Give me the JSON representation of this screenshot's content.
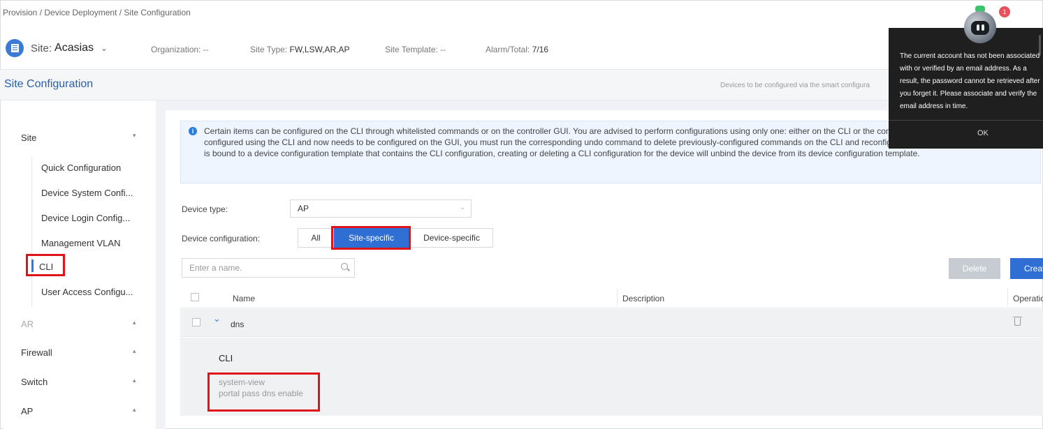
{
  "breadcrumb": "Provision / Device Deployment / Site Configuration",
  "site": {
    "label": "Site:",
    "name": "Acasias",
    "organization": "Organization: --",
    "site_type_label": "Site Type:",
    "site_type_value": "FW,LSW,AR,AP",
    "site_template": "Site Template: --",
    "alarm_label": "Alarm/Total:",
    "alarm_value": "7/16"
  },
  "section": {
    "title": "Site Configuration",
    "smart_note": "Devices to be configured via the smart configura"
  },
  "sidebar": {
    "groups": [
      {
        "label": "Site"
      },
      {
        "label": "AR"
      },
      {
        "label": "Firewall"
      },
      {
        "label": "Switch"
      },
      {
        "label": "AP"
      }
    ],
    "items": [
      {
        "label": "Quick Configuration"
      },
      {
        "label": "Device System Confi..."
      },
      {
        "label": "Device Login Config..."
      },
      {
        "label": "Management VLAN"
      },
      {
        "label": "CLI"
      },
      {
        "label": "User Access Configu..."
      }
    ]
  },
  "info": {
    "text": "Certain items can be configured on the CLI through whitelisted commands or on the controller GUI. You are advised to perform configurations using only one: either on the CLI or the controller GUI. If a function is previously configured using the CLI and now needs to be configured on the GUI, you must run the corresponding undo command to delete previously-configured commands on the CLI and reconfigure the function on the GUI.If a device is bound to a device configuration template that contains the CLI configuration, creating or deleting a CLI configuration for the device will unbind the device from its device configuration template."
  },
  "form": {
    "device_type_label": "Device type:",
    "device_type_value": "AP",
    "device_config_label": "Device configuration:",
    "segments": [
      "All",
      "Site-specific",
      "Device-specific"
    ],
    "selected_segment": "Site-specific"
  },
  "search": {
    "placeholder": "Enter a name."
  },
  "actions": {
    "delete": "Delete",
    "create": "Create"
  },
  "table": {
    "columns": [
      "Name",
      "Description",
      "Operation"
    ],
    "rows": [
      {
        "name": "dns",
        "description": "",
        "expanded": true,
        "detail_title": "CLI",
        "detail_lines": [
          "system-view",
          "portal pass dns enable"
        ]
      }
    ]
  },
  "toast": {
    "message": "The current account has not been associated with or verified by an email address. As a result, the password cannot be retrieved after you forget it. Please associate and verify the email address in time.",
    "ok_label": "OK",
    "badge_count": "1"
  },
  "colors": {
    "accent": "#2f6fd4",
    "highlight": "#e0131b",
    "link": "#2a5fa8"
  }
}
